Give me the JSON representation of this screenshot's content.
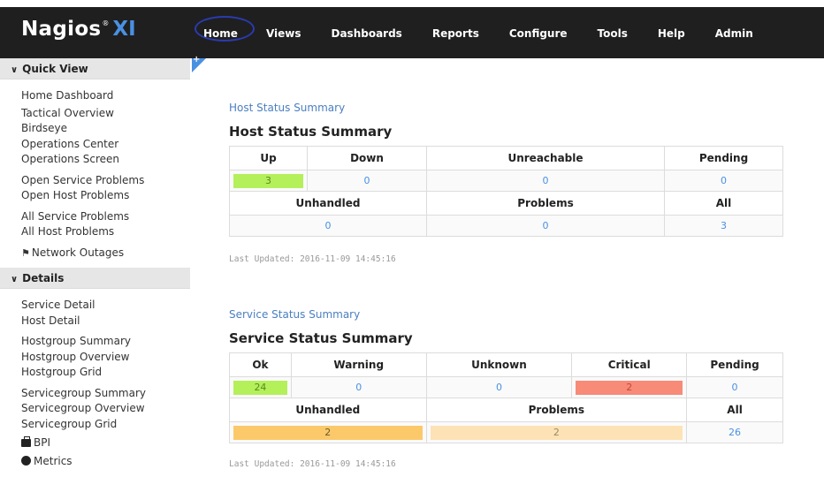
{
  "logo": {
    "name": "Nagios",
    "reg": "®",
    "suffix": "XI"
  },
  "nav": {
    "items": [
      "Home",
      "Views",
      "Dashboards",
      "Reports",
      "Configure",
      "Tools",
      "Help",
      "Admin"
    ]
  },
  "sidebar": {
    "quick_view": {
      "title": "Quick View",
      "groups": [
        [
          "Home Dashboard",
          "Tactical Overview",
          "Birdseye",
          "Operations Center",
          "Operations Screen"
        ],
        [
          "Open Service Problems",
          "Open Host Problems"
        ],
        [
          "All Service Problems",
          "All Host Problems"
        ]
      ],
      "network_outages": "Network Outages"
    },
    "details": {
      "title": "Details",
      "groups": [
        [
          "Service Detail",
          "Host Detail"
        ],
        [
          "Hostgroup Summary",
          "Hostgroup Overview",
          "Hostgroup Grid"
        ],
        [
          "Servicegroup Summary",
          "Servicegroup Overview",
          "Servicegroup Grid"
        ]
      ],
      "bpi": "BPI",
      "metrics": "Metrics"
    }
  },
  "host_summary": {
    "crumb": "Host Status Summary",
    "title": "Host Status Summary",
    "headers": [
      "Up",
      "Down",
      "Unreachable",
      "Pending"
    ],
    "values": [
      "3",
      "0",
      "0",
      "0"
    ],
    "headers2": [
      "Unhandled",
      "Problems",
      "All"
    ],
    "values2": [
      "0",
      "0",
      "3"
    ],
    "updated": "Last Updated: 2016-11-09 14:45:16"
  },
  "service_summary": {
    "crumb": "Service Status Summary",
    "title": "Service Status Summary",
    "headers": [
      "Ok",
      "Warning",
      "Unknown",
      "Critical",
      "Pending"
    ],
    "values": [
      "24",
      "0",
      "0",
      "2",
      "0"
    ],
    "headers2": [
      "Unhandled",
      "Problems",
      "All"
    ],
    "values2": [
      "2",
      "2",
      "26"
    ],
    "updated": "Last Updated: 2016-11-09 14:45:16"
  },
  "colors": {
    "ok": "#b4f05a",
    "critical": "#f88a78",
    "unhandled": "#fbc96a",
    "problems": "#fde2b6",
    "link": "#4a90e2"
  }
}
